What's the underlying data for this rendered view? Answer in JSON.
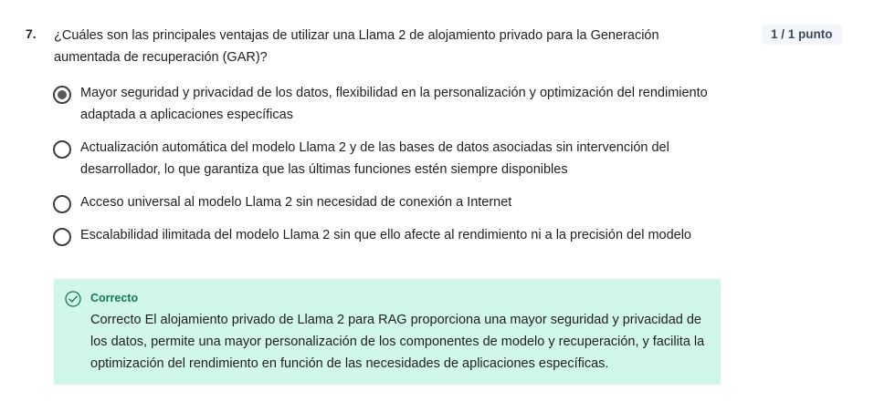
{
  "question": {
    "number": "7.",
    "text": "¿Cuáles son las principales ventajas de utilizar una Llama 2 de alojamiento privado para la Generación aumentada de recuperación (GAR)?",
    "score": "1 / 1 punto"
  },
  "options": [
    {
      "text": "Mayor seguridad y privacidad de los datos, flexibilidad en la personalización y optimización del rendimiento adaptada a aplicaciones específicas",
      "selected": true
    },
    {
      "text": "Actualización automática del modelo Llama 2 y de las bases de datos asociadas sin intervención del desarrollador, lo que garantiza que las últimas funciones estén siempre disponibles",
      "selected": false
    },
    {
      "text": "Acceso universal al modelo Llama 2 sin necesidad de conexión a Internet",
      "selected": false
    },
    {
      "text": "Escalabilidad ilimitada del modelo Llama 2 sin que ello afecte al rendimiento ni a la precisión del modelo",
      "selected": false
    }
  ],
  "feedback": {
    "title": "Correcto",
    "text": "Correcto El alojamiento privado de Llama 2 para RAG proporciona una mayor seguridad y privacidad de los datos, permite una mayor personalización de los componentes de modelo y recuperación, y facilita la optimización del rendimiento en función de las necesidades de aplicaciones específicas.",
    "icon": "check-circle-icon",
    "bg_color": "#d1f6ea",
    "accent_color": "#137a52"
  }
}
